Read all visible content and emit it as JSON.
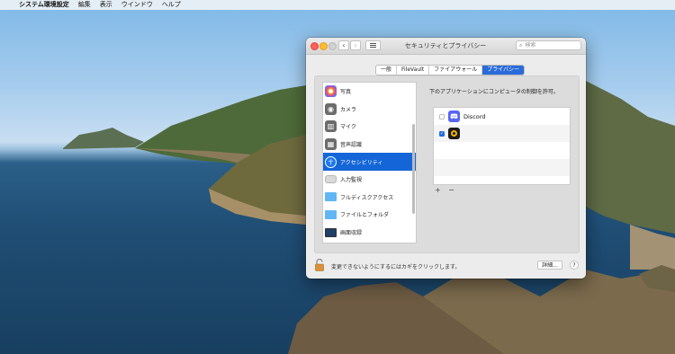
{
  "menubar": {
    "apple": "",
    "app_name": "システム環境設定",
    "items": [
      "編集",
      "表示",
      "ウインドウ",
      "ヘルプ"
    ]
  },
  "window": {
    "title": "セキュリティとプライバシー",
    "search_placeholder": "検索",
    "tabs": [
      "一般",
      "FileVault",
      "ファイアウォール",
      "プライバシー"
    ],
    "active_tab": "プライバシー"
  },
  "categories": [
    {
      "label": "写真",
      "icon": "photos-icon"
    },
    {
      "label": "カメラ",
      "icon": "camera-icon"
    },
    {
      "label": "マイク",
      "icon": "microphone-icon"
    },
    {
      "label": "音声認識",
      "icon": "speech-recognition-icon"
    },
    {
      "label": "アクセシビリティ",
      "icon": "accessibility-icon",
      "selected": true
    },
    {
      "label": "入力監視",
      "icon": "keyboard-icon"
    },
    {
      "label": "フルディスクアクセス",
      "icon": "folder-icon"
    },
    {
      "label": "ファイルとフォルダ",
      "icon": "folder-icon"
    },
    {
      "label": "画面収録",
      "icon": "display-icon"
    }
  ],
  "right": {
    "heading": "下のアプリケーションにコンピュータの制御を許可。",
    "apps": [
      {
        "name": "Discord",
        "checked": false,
        "icon": "discord-icon"
      },
      {
        "name": "",
        "checked": true,
        "icon": "app-icon"
      }
    ],
    "add_label": "+",
    "remove_label": "−"
  },
  "footer": {
    "lock_text": "変更できないようにするにはカギをクリックします。",
    "details_label": "詳細...",
    "help_label": "?"
  },
  "colors": {
    "accent": "#1466d8",
    "discord": "#5865f2"
  }
}
